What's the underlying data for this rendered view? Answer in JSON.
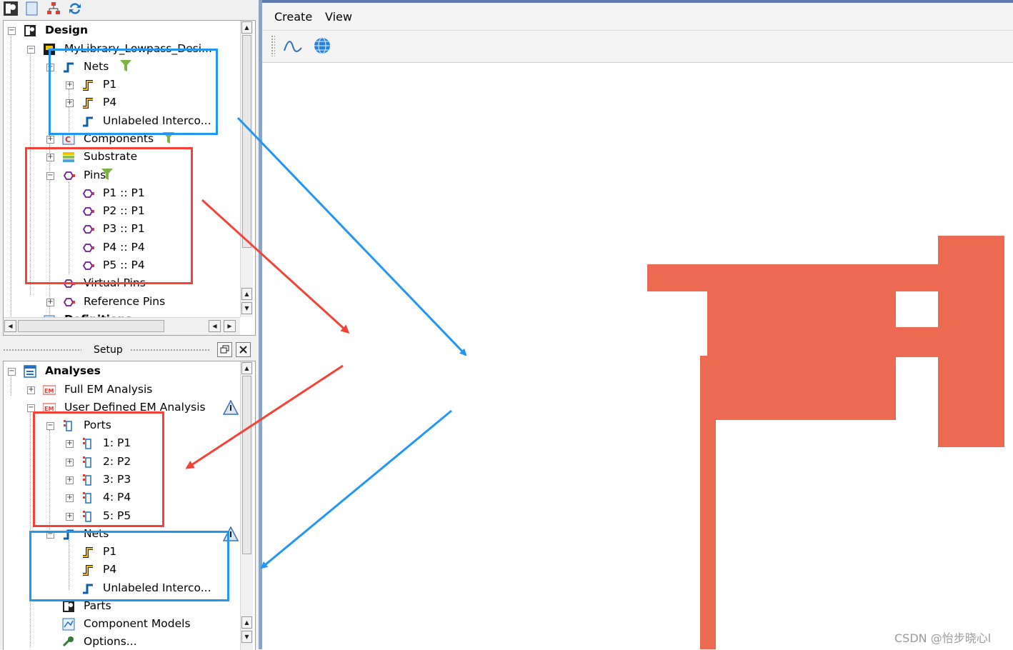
{
  "layout_panel": {
    "root": "Design",
    "library_item": "MyLibrary_Lowpass_Desi...",
    "items": {
      "nets": "Nets",
      "p1": "P1",
      "p4": "P4",
      "unlabeled": "Unlabeled Interco...",
      "components": "Components",
      "substrate": "Substrate",
      "pins": "Pins",
      "pin_list": [
        "P1 :: P1",
        "P2 :: P1",
        "P3 :: P1",
        "P4 :: P4",
        "P5 :: P4"
      ],
      "virtual_pins": "Virtual Pins",
      "reference_pins": "Reference Pins",
      "definitions": "Definitions"
    }
  },
  "setup_panel": {
    "title": "Setup",
    "root": "Analyses",
    "full_em": "Full EM Analysis",
    "user_em": "User Defined EM Analysis",
    "ports": "Ports",
    "port_list": [
      "1: P1",
      "2: P2",
      "3: P3",
      "4: P4",
      "5: P5"
    ],
    "nets": "Nets",
    "net_list": [
      "P1",
      "P4",
      "Unlabeled Interco..."
    ],
    "parts": "Parts",
    "component_models": "Component Models",
    "options": "Options..."
  },
  "menubar": {
    "create": "Create",
    "view": "View"
  },
  "watermark": "CSDN @怡步晓心l",
  "colors": {
    "trace": "#ec6a52",
    "highlight_blue": "#2196f3",
    "highlight_red": "#f44336",
    "panel_bg": "#f0f0f0"
  }
}
